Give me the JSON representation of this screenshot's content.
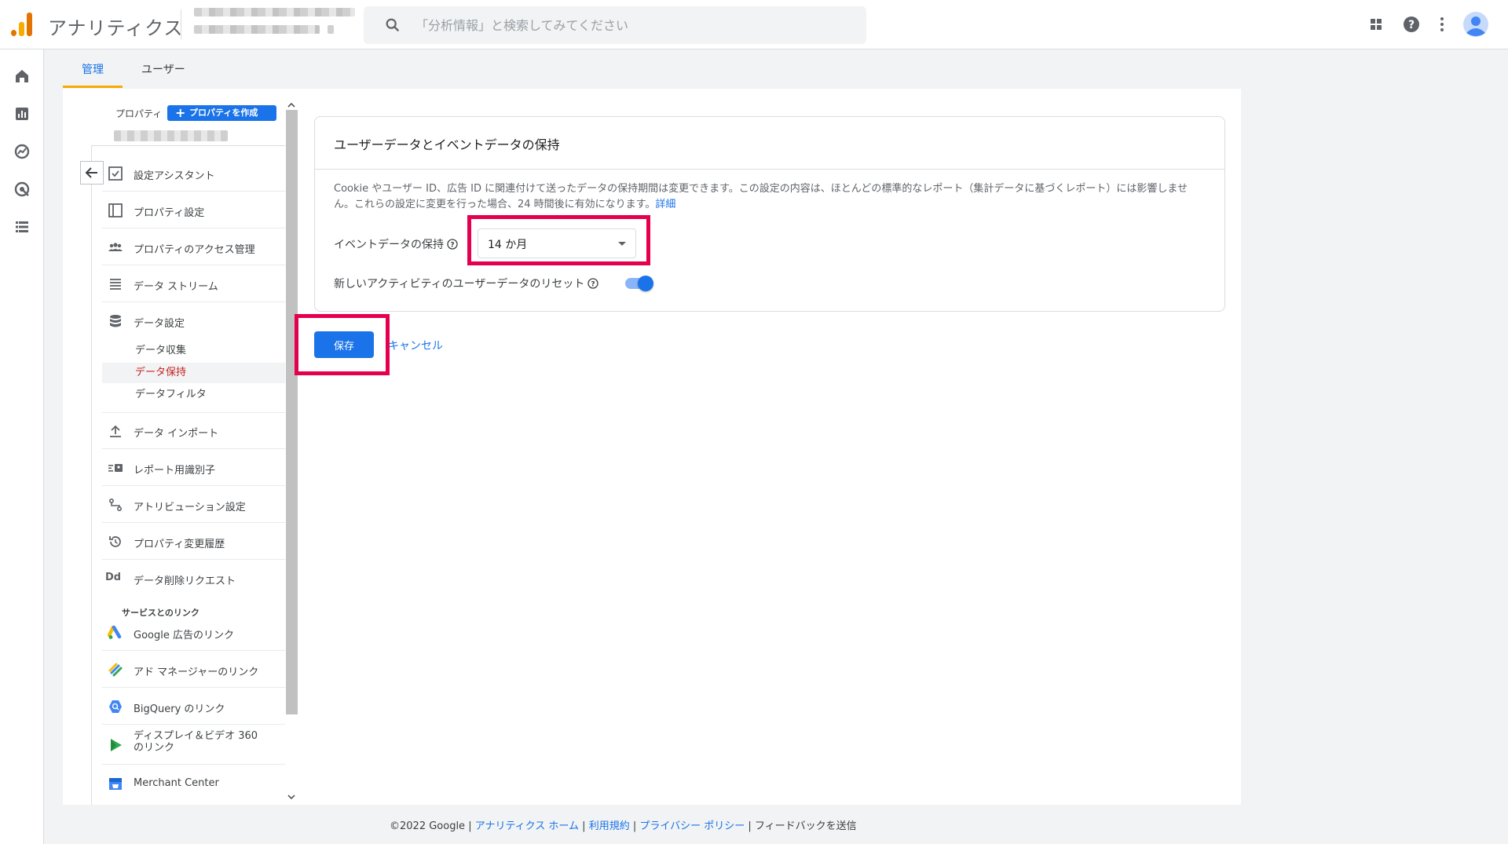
{
  "app": {
    "title": "アナリティクス"
  },
  "search": {
    "placeholder": "「分析情報」と検索してみてください"
  },
  "tabs": {
    "admin": "管理",
    "user": "ユーザー"
  },
  "property_panel": {
    "label": "プロパティ",
    "create_button": "プロパティを作成"
  },
  "nav": {
    "items": [
      {
        "label": "設定アシスタント",
        "icon": "checklist-icon"
      },
      {
        "label": "プロパティ設定",
        "icon": "property-settings-icon"
      },
      {
        "label": "プロパティのアクセス管理",
        "icon": "people-icon"
      },
      {
        "label": "データ ストリーム",
        "icon": "data-streams-icon"
      },
      {
        "label": "データ設定",
        "icon": "database-icon"
      }
    ],
    "data_sub": [
      {
        "label": "データ収集"
      },
      {
        "label": "データ保持"
      },
      {
        "label": "データフィルタ"
      }
    ],
    "items2": [
      {
        "label": "データ インポート",
        "icon": "upload-icon"
      },
      {
        "label": "レポート用識別子",
        "icon": "identifier-icon"
      },
      {
        "label": "アトリビューション設定",
        "icon": "attribution-icon"
      },
      {
        "label": "プロパティ変更履歴",
        "icon": "history-icon"
      },
      {
        "label": "データ削除リクエスト",
        "icon": "dd-icon",
        "glyph": "Dd"
      }
    ],
    "links_heading": "サービスとのリンク",
    "links": [
      {
        "label": "Google 広告のリンク",
        "icon": "google-ads-icon"
      },
      {
        "label": "アド マネージャーのリンク",
        "icon": "ad-manager-icon"
      },
      {
        "label": "BigQuery のリンク",
        "icon": "bigquery-icon"
      },
      {
        "label_line1": "ディスプレイ＆ビデオ 360",
        "label_line2": "のリンク",
        "icon": "dv360-icon"
      },
      {
        "label": "Merchant Center",
        "icon": "merchant-center-icon"
      }
    ]
  },
  "card": {
    "title": "ユーザーデータとイベントデータの保持",
    "description": "Cookie やユーザー ID、広告 ID に関連付けて送ったデータの保持期間は変更できます。この設定の内容は、ほとんどの標準的なレポート（集計データに基づくレポート）には影響しません。これらの設定に変更を行った場合、24 時間後に有効になります。",
    "details_link": "詳細",
    "event_retention_label": "イベントデータの保持",
    "event_retention_value": "14 か月",
    "reset_label": "新しいアクティビティのユーザーデータのリセット",
    "reset_enabled": true
  },
  "actions": {
    "save": "保存",
    "cancel": "キャンセル"
  },
  "footer": {
    "copyright": "©2022 Google |",
    "analytics_home": "アナリティクス ホーム",
    "sep1": "|",
    "terms": "利用規約",
    "sep2": "|",
    "privacy": "プライバシー ポリシー",
    "sep3": "|",
    "feedback": "フィードバックを送信"
  },
  "colors": {
    "accent": "#1a73e8",
    "highlight": "#e5004f",
    "active_sub": "#c5221f",
    "tab_underline": "#f9ab00"
  }
}
